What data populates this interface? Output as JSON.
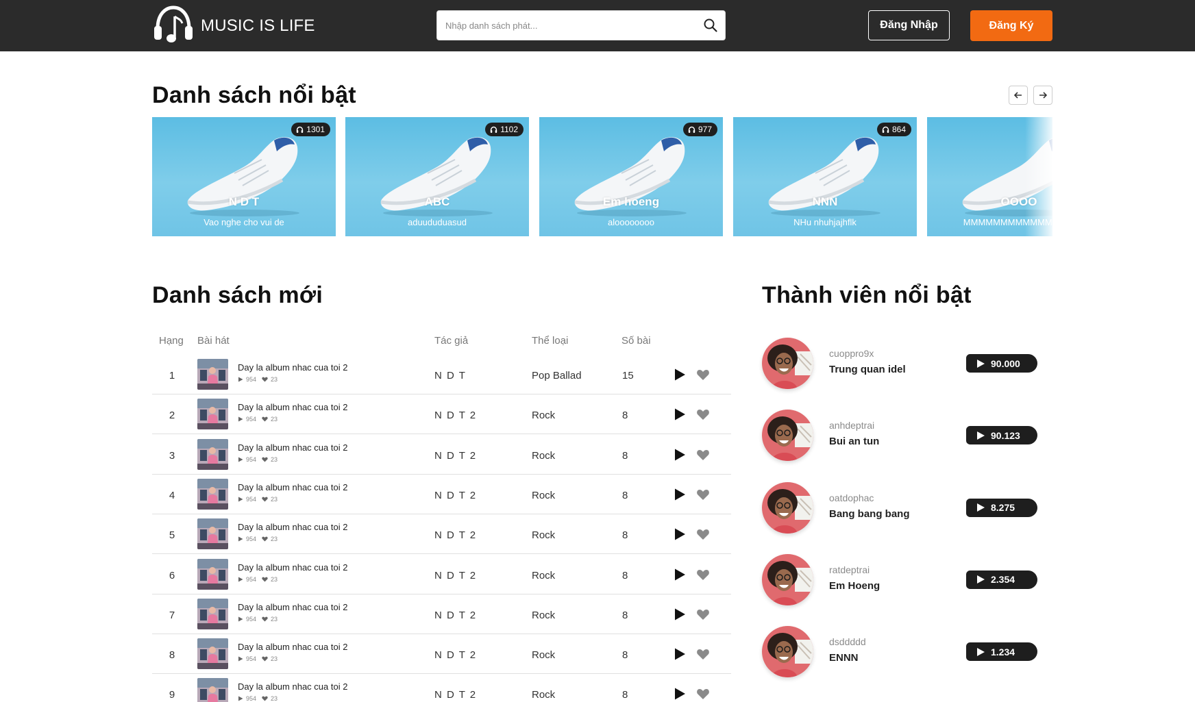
{
  "header": {
    "brand": "MUSIC IS LIFE",
    "search_placeholder": "Nhập danh sách phát...",
    "login_label": "Đăng Nhập",
    "register_label": "Đăng Ký",
    "accent_color": "#f26a12"
  },
  "featured": {
    "title": "Danh sách nổi bật",
    "cards": [
      {
        "title": "N D T",
        "subtitle": "Vao nghe cho vui de",
        "listens": "1301"
      },
      {
        "title": "ABC",
        "subtitle": "aduududuasud",
        "listens": "1102"
      },
      {
        "title": "Em hoeng",
        "subtitle": "aloooooooo",
        "listens": "977"
      },
      {
        "title": "NNN",
        "subtitle": "NHu nhuhjajhflk",
        "listens": "864"
      },
      {
        "title": "OOOO",
        "subtitle": "MMMMMMMMMMMMMMM",
        "listens": ""
      }
    ]
  },
  "new_list": {
    "title": "Danh sách mới",
    "headers": {
      "rank": "Hạng",
      "song": "Bài hát",
      "author": "Tác giả",
      "genre": "Thể loại",
      "count": "Số bài"
    },
    "rows": [
      {
        "rank": "1",
        "title": "Day la album nhac cua toi 2",
        "plays": "954",
        "likes": "23",
        "author": "N D T",
        "genre": "Pop Ballad",
        "count": "15"
      },
      {
        "rank": "2",
        "title": "Day la album nhac cua toi 2",
        "plays": "954",
        "likes": "23",
        "author": "N D T 2",
        "genre": "Rock",
        "count": "8"
      },
      {
        "rank": "3",
        "title": "Day la album nhac cua toi 2",
        "plays": "954",
        "likes": "23",
        "author": "N D T 2",
        "genre": "Rock",
        "count": "8"
      },
      {
        "rank": "4",
        "title": "Day la album nhac cua toi 2",
        "plays": "954",
        "likes": "23",
        "author": "N D T 2",
        "genre": "Rock",
        "count": "8"
      },
      {
        "rank": "5",
        "title": "Day la album nhac cua toi 2",
        "plays": "954",
        "likes": "23",
        "author": "N D T 2",
        "genre": "Rock",
        "count": "8"
      },
      {
        "rank": "6",
        "title": "Day la album nhac cua toi 2",
        "plays": "954",
        "likes": "23",
        "author": "N D T 2",
        "genre": "Rock",
        "count": "8"
      },
      {
        "rank": "7",
        "title": "Day la album nhac cua toi 2",
        "plays": "954",
        "likes": "23",
        "author": "N D T 2",
        "genre": "Rock",
        "count": "8"
      },
      {
        "rank": "8",
        "title": "Day la album nhac cua toi 2",
        "plays": "954",
        "likes": "23",
        "author": "N D T 2",
        "genre": "Rock",
        "count": "8"
      },
      {
        "rank": "9",
        "title": "Day la album nhac cua toi 2",
        "plays": "954",
        "likes": "23",
        "author": "N D T 2",
        "genre": "Rock",
        "count": "8"
      }
    ]
  },
  "members": {
    "title": "Thành viên nổi bật",
    "items": [
      {
        "username": "cuoppro9x",
        "name": "Trung quan idel",
        "plays": "90.000"
      },
      {
        "username": "anhdeptrai",
        "name": "Bui an tun",
        "plays": "90.123"
      },
      {
        "username": "oatdophac",
        "name": "Bang bang bang",
        "plays": "8.275"
      },
      {
        "username": "ratdeptrai",
        "name": "Em Hoeng",
        "plays": "2.354"
      },
      {
        "username": "dsddddd",
        "name": "ENNN",
        "plays": "1.234"
      }
    ]
  }
}
